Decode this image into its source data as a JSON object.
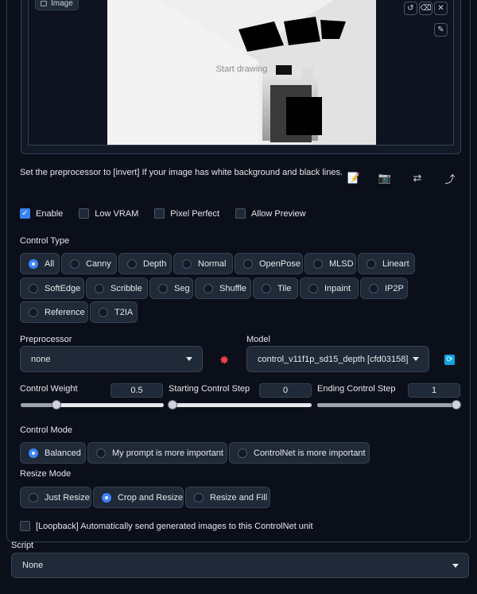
{
  "image_panel": {
    "label": "Image",
    "canvas_hint": "Start drawing",
    "icons": [
      "undo-icon",
      "eraser-icon",
      "close-icon",
      "pen-icon"
    ]
  },
  "hint_text": "Set the preprocessor to [invert] If your image has white background and black lines.",
  "options": [
    {
      "label": "Enable",
      "checked": true
    },
    {
      "label": "Low VRAM",
      "checked": false
    },
    {
      "label": "Pixel Perfect",
      "checked": false
    },
    {
      "label": "Allow Preview",
      "checked": false
    }
  ],
  "control_type": {
    "label": "Control Type",
    "items": [
      "All",
      "Canny",
      "Depth",
      "Normal",
      "OpenPose",
      "MLSD",
      "Lineart",
      "SoftEdge",
      "Scribble",
      "Seg",
      "Shuffle",
      "Tile",
      "Inpaint",
      "IP2P",
      "Reference",
      "T2IA"
    ],
    "selected": "All"
  },
  "preprocessor": {
    "label": "Preprocessor",
    "value": "none"
  },
  "model": {
    "label": "Model",
    "value": "control_v11f1p_sd15_depth [cfd03158]"
  },
  "sliders": {
    "weight": {
      "label": "Control Weight",
      "value": "0.5",
      "fraction": 0.25
    },
    "start": {
      "label": "Starting Control Step",
      "value": "0",
      "fraction": 0.0
    },
    "end": {
      "label": "Ending Control Step",
      "value": "1",
      "fraction": 1.0
    }
  },
  "control_mode": {
    "label": "Control Mode",
    "items": [
      "Balanced",
      "My prompt is more important",
      "ControlNet is more important"
    ],
    "selected": "Balanced"
  },
  "resize_mode": {
    "label": "Resize Mode",
    "items": [
      "Just Resize",
      "Crop and Resize",
      "Resize and Fill"
    ],
    "selected": "Crop and Resize"
  },
  "loopback": {
    "label": "[Loopback] Automatically send generated images to this ControlNet unit",
    "checked": false
  },
  "script": {
    "label": "Script",
    "value": "None"
  },
  "colors": {
    "accent": "#3b82f6",
    "background": "#0b0f19",
    "panel": "#1f2937",
    "border": "#374151"
  }
}
